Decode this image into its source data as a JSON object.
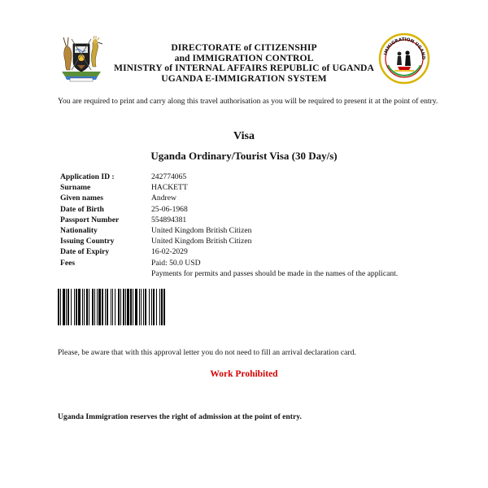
{
  "header": {
    "line1": "DIRECTORATE of CITIZENSHIP",
    "line2": "and IMMIGRATION CONTROL",
    "line3": "MINISTRY of INTERNAL AFFAIRS REPUBLIC of UGANDA",
    "line4": "UGANDA E-IMMIGRATION SYSTEM",
    "seal_text": "IMMIGRATION UGANDA"
  },
  "intro": "You are required to print and carry along this travel authorisation as you will be required to present it at the point of entry.",
  "document_title": "Visa",
  "visa_type": "Uganda Ordinary/Tourist Visa (30 Day/s)",
  "details": [
    {
      "label": "Application ID :",
      "value": "242774065"
    },
    {
      "label": "Surname",
      "value": "HACKETT"
    },
    {
      "label": "Given names",
      "value": "Andrew"
    },
    {
      "label": "Date of Birth",
      "value": "25-06-1968"
    },
    {
      "label": "Passport Number",
      "value": "554894381"
    },
    {
      "label": "Nationality",
      "value": "United Kingdom British Citizen"
    },
    {
      "label": "Issuing Country",
      "value": "United Kingdom British Citizen"
    },
    {
      "label": "Date of Expiry",
      "value": "16-02-2029"
    },
    {
      "label": "Fees",
      "value": "Paid: 50.0 USD"
    }
  ],
  "payment_note": "Payments for permits and passes should be made in the names of the applicant.",
  "arrival_note": "Please, be aware that with this approval letter you do not need to fill an arrival declaration card.",
  "work_status": "Work Prohibited",
  "reservation_note": "Uganda Immigration reserves the right of admission at the point of entry.",
  "colors": {
    "work_status": "#d40000",
    "text": "#111111"
  }
}
